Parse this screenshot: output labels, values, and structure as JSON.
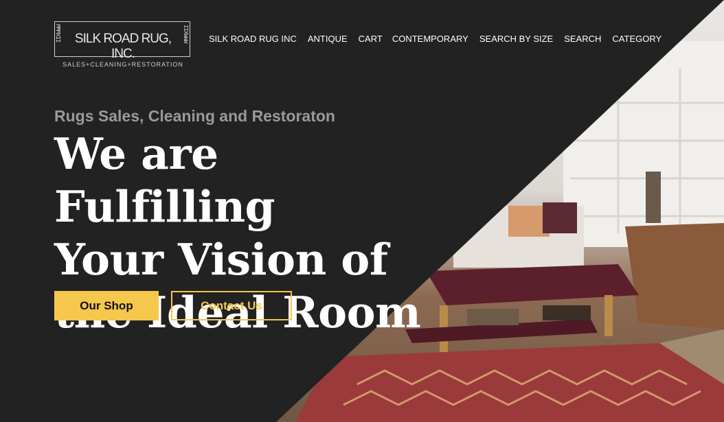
{
  "brand": {
    "name": "SILK ROAD RUG, INC.",
    "tagline": "SALES+CLEANING+RESTORATION",
    "side_pattern": "IIXWWW"
  },
  "nav": {
    "items": [
      {
        "label": "SILK ROAD RUG INC"
      },
      {
        "label": "ANTIQUE"
      },
      {
        "label": "CART"
      },
      {
        "label": "CONTEMPORARY"
      },
      {
        "label": "SEARCH BY SIZE"
      },
      {
        "label": "SEARCH"
      },
      {
        "label": "CATEGORY"
      }
    ]
  },
  "hero": {
    "kicker": "Rugs Sales, Cleaning and Restoraton",
    "headline_line1": "We are Fulfilling",
    "headline_line2": "Your Vision of",
    "headline_line3": "the Ideal Room",
    "primary_button": "Our Shop",
    "secondary_button": "Contact Us"
  },
  "colors": {
    "background": "#222222",
    "accent": "#f5c74c",
    "kicker": "#9a9a9a",
    "text": "#ffffff"
  }
}
